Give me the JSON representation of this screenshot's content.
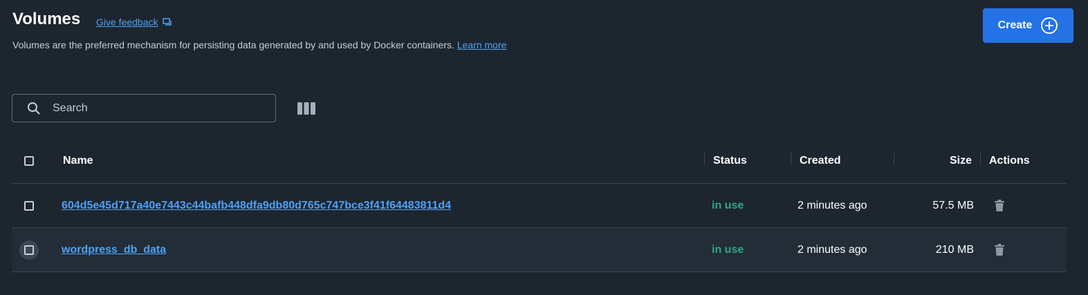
{
  "header": {
    "title": "Volumes",
    "feedback_label": "Give feedback",
    "description": "Volumes are the preferred mechanism for persisting data generated by and used by Docker containers.",
    "learn_more_label": "Learn more",
    "create_label": "Create"
  },
  "search": {
    "placeholder": "Search",
    "value": ""
  },
  "table": {
    "columns": {
      "name": "Name",
      "status": "Status",
      "created": "Created",
      "size": "Size",
      "actions": "Actions"
    },
    "rows": [
      {
        "name": "604d5e45d717a40e7443c44bafb448dfa9db80d765c747bce3f41f64483811d4",
        "status": "in use",
        "created": "2 minutes ago",
        "size": "57.5 MB"
      },
      {
        "name": "wordpress_db_data",
        "status": "in use",
        "created": "2 minutes ago",
        "size": "210 MB"
      }
    ]
  },
  "colors": {
    "background": "#1d262f",
    "accent": "#2472e5",
    "link": "#4ea1f5",
    "status_in_use": "#2fa882"
  },
  "icons": {
    "feedback": "feedback-icon",
    "create": "plus-circle-icon",
    "search": "search-icon",
    "columns": "columns-icon",
    "delete": "trash-icon"
  }
}
